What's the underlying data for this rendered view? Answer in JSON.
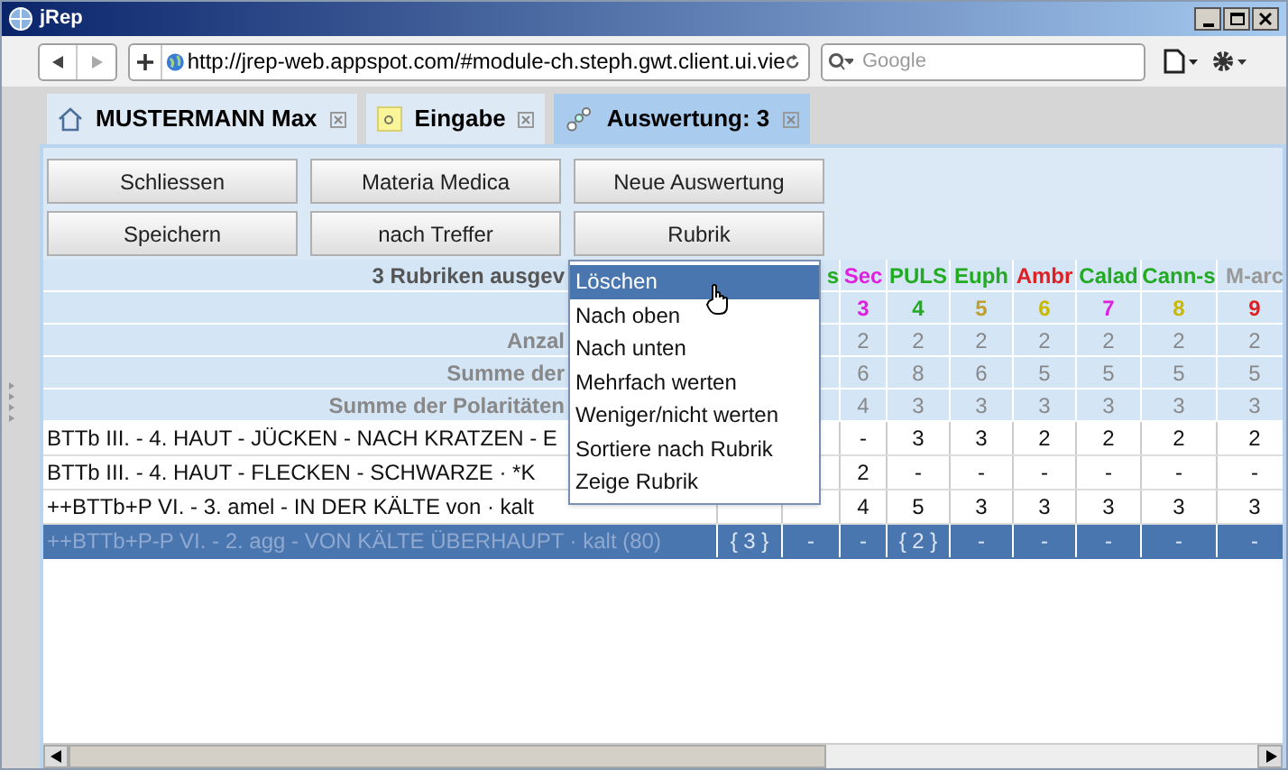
{
  "window": {
    "title": "jRep"
  },
  "browser": {
    "url": "http://jrep-web.appspot.com/#module-ch.steph.gwt.client.ui.vie",
    "search_placeholder": "Google"
  },
  "tabs": [
    {
      "label": "MUSTERMANN Max",
      "kind": "home",
      "selected": false
    },
    {
      "label": "Eingabe",
      "kind": "input",
      "selected": false
    },
    {
      "label": "Auswertung: 3",
      "kind": "chart",
      "selected": true
    }
  ],
  "buttons": [
    [
      "Schliessen",
      "Materia Medica",
      "Neue Auswertung"
    ],
    [
      "Speichern",
      "nach Treffer",
      "Rubrik"
    ]
  ],
  "table": {
    "title": "3 Rubriken ausgev",
    "columns": [
      {},
      {
        "header": {
          "text": "s",
          "color": "#22aa22"
        }
      },
      {
        "header": {
          "text": "Sec",
          "color": "#e020e0"
        },
        "number": {
          "text": "3",
          "color": "#e020e0"
        }
      },
      {
        "header": {
          "text": "PULS",
          "color": "#22aa22"
        },
        "number": {
          "text": "4",
          "color": "#22aa22"
        }
      },
      {
        "header": {
          "text": "Euph",
          "color": "#22aa22"
        },
        "number": {
          "text": "5",
          "color": "#c0a030"
        }
      },
      {
        "header": {
          "text": "Ambr",
          "color": "#e02020"
        },
        "number": {
          "text": "6",
          "color": "#c8b800"
        }
      },
      {
        "header": {
          "text": "Calad",
          "color": "#22aa22"
        },
        "number": {
          "text": "7",
          "color": "#e020e0"
        }
      },
      {
        "header": {
          "text": "Cann-s",
          "color": "#22aa22"
        },
        "number": {
          "text": "8",
          "color": "#c8b800"
        }
      },
      {
        "header": {
          "text": "M-arc",
          "color": "#999999"
        },
        "number": {
          "text": "9",
          "color": "#e02020"
        }
      }
    ],
    "summary_rows": [
      {
        "label": "Anzal",
        "cells": [
          null,
          null,
          "2",
          "2",
          "2",
          "2",
          "2",
          "2",
          "2"
        ]
      },
      {
        "label": "Summe der",
        "cells": [
          null,
          null,
          "6",
          "8",
          "6",
          "5",
          "5",
          "5",
          "5"
        ]
      },
      {
        "label": "Summe der Polaritäten",
        "cells": [
          null,
          null,
          "4",
          "3",
          "3",
          "3",
          "3",
          "3",
          "3"
        ]
      }
    ],
    "rows": [
      {
        "text": "BTTb  III. - 4. HAUT - JÜCKEN - NACH KRATZEN - E",
        "selected": false,
        "cells": [
          null,
          null,
          "-",
          "3",
          "3",
          "2",
          "2",
          "2",
          "2"
        ]
      },
      {
        "text": "BTTb  III. - 4. HAUT - FLECKEN - SCHWARZE · *K",
        "selected": false,
        "cells": [
          null,
          null,
          "2",
          "-",
          "-",
          "-",
          "-",
          "-",
          "-"
        ]
      },
      {
        "text": "++BTTb+P  VI. - 3. amel - IN DER KÄLTE von · kalt",
        "selected": false,
        "cells": [
          null,
          null,
          "4",
          "5",
          "3",
          "3",
          "3",
          "3",
          "3"
        ]
      },
      {
        "text": "++BTTb+P-P  VI. - 2. agg - VON KÄLTE ÜBERHAUPT · kalt (80)",
        "selected": true,
        "cells": [
          "{ 3 }",
          "-",
          "-",
          "{ 2 }",
          "-",
          "-",
          "-",
          "-",
          "-"
        ]
      }
    ]
  },
  "context_menu": [
    {
      "label": "Löschen",
      "selected": true
    },
    {
      "label": "Nach oben",
      "selected": false
    },
    {
      "label": "Nach unten",
      "selected": false
    },
    {
      "label": "Mehrfach werten",
      "selected": false
    },
    {
      "label": "Weniger/nicht werten",
      "selected": false
    },
    {
      "label": "Sortiere nach Rubrik",
      "selected": false
    },
    {
      "label": "Zeige Rubrik",
      "selected": false
    }
  ]
}
